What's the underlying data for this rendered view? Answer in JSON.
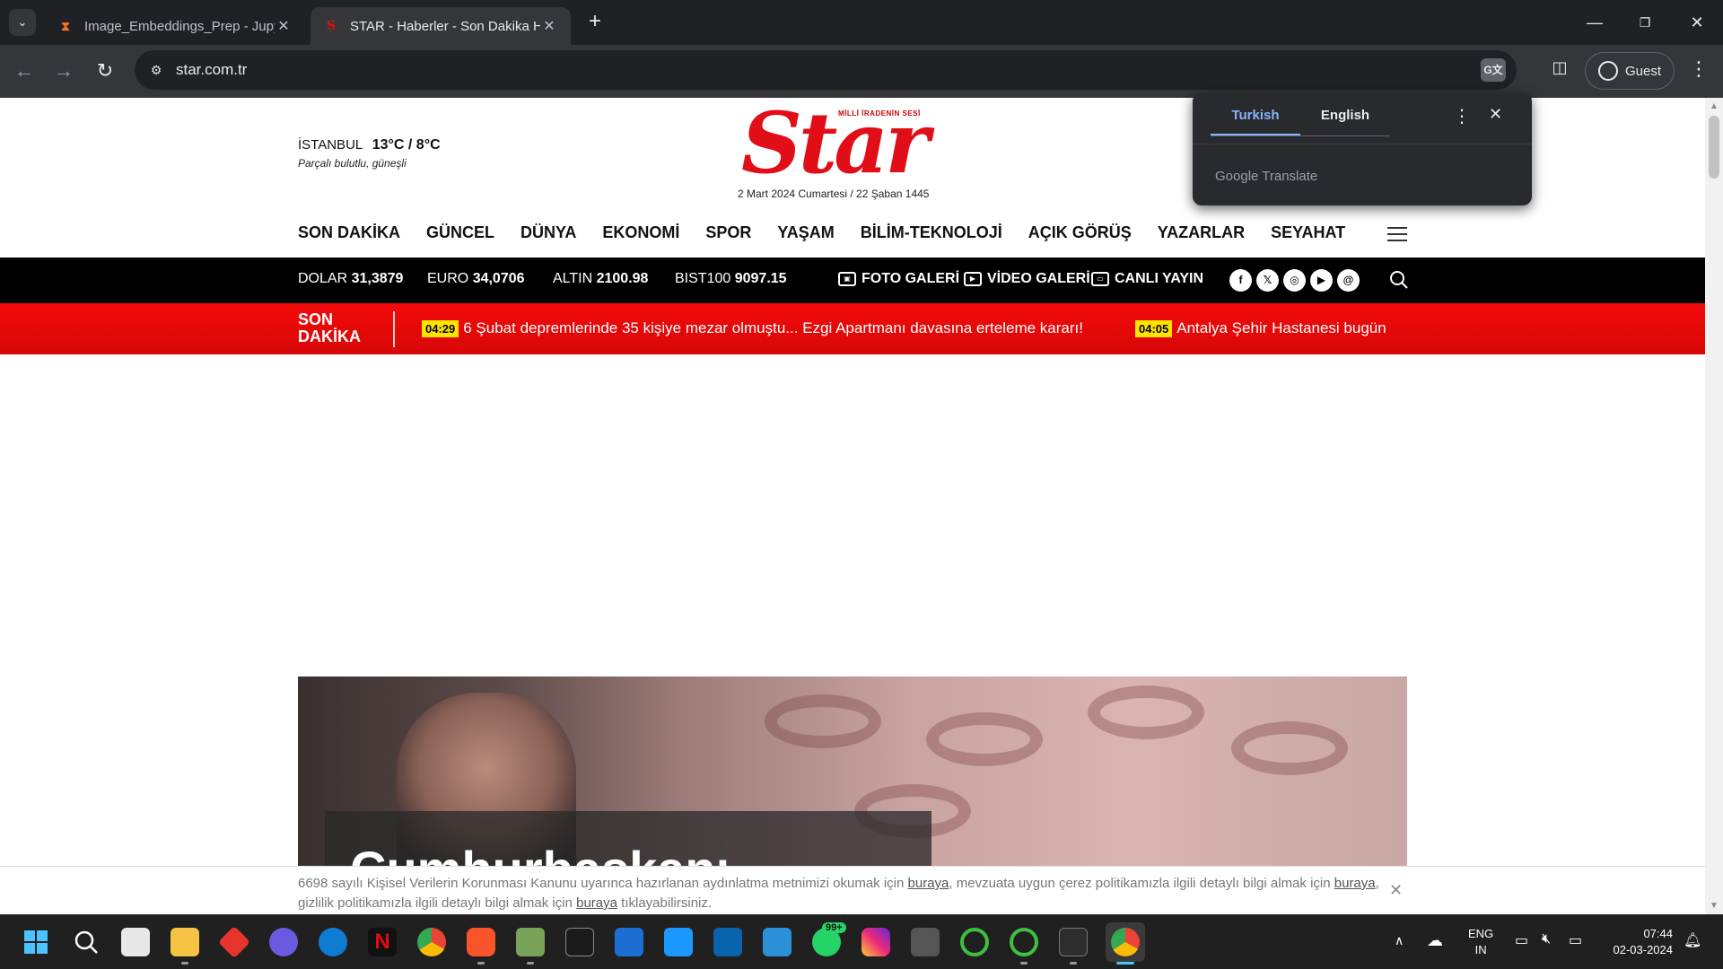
{
  "browser": {
    "tabs": [
      {
        "title": "Image_Embeddings_Prep - Jupyt",
        "favicon": "hourglass-icon",
        "active": false
      },
      {
        "title": "STAR - Haberler - Son Dakika H",
        "favicon": "star-s-icon",
        "active": true
      }
    ],
    "url": "star.com.tr",
    "profile_label": "Guest",
    "translate_popup": {
      "source_lang": "Turkish",
      "target_lang": "English",
      "brand": "Google Translate"
    }
  },
  "site": {
    "weather": {
      "city": "İSTANBUL",
      "temp": "13°C / 8°C",
      "desc": "Parçalı bulutlu, güneşli"
    },
    "logo": {
      "word": "Star",
      "tagline": "MİLLİ İRADENİN SESİ"
    },
    "date": "2 Mart 2024 Cumartesi / 22 Şaban 1445",
    "nav": [
      "SON DAKİKA",
      "GÜNCEL",
      "DÜNYA",
      "EKONOMİ",
      "SPOR",
      "YAŞAM",
      "BİLİM-TEKNOLOJİ",
      "AÇIK GÖRÜŞ",
      "YAZARLAR",
      "SEYAHAT"
    ],
    "markets": [
      {
        "name": "DOLAR",
        "value": "31,3879"
      },
      {
        "name": "EURO",
        "value": "34,0706"
      },
      {
        "name": "ALTIN",
        "value": "2100.98"
      },
      {
        "name": "BIST100",
        "value": "9097.15"
      }
    ],
    "media_links": [
      {
        "label": "FOTO GALERİ",
        "icon": "photo-gallery-icon"
      },
      {
        "label": "VİDEO GALERİ",
        "icon": "video-gallery-icon"
      },
      {
        "label": "CANLI YAYIN",
        "icon": "live-tv-icon"
      }
    ],
    "social": [
      {
        "icon": "facebook-icon",
        "glyph": "f"
      },
      {
        "icon": "x-icon",
        "glyph": "𝕏"
      },
      {
        "icon": "instagram-icon",
        "glyph": "◎"
      },
      {
        "icon": "youtube-icon",
        "glyph": "▶"
      },
      {
        "icon": "threads-icon",
        "glyph": "@"
      }
    ],
    "breaking": {
      "label_line1": "SON",
      "label_line2": "DAKİKA",
      "items": [
        {
          "time": "04:29",
          "text": "6 Şubat depremlerinde 35 kişiye mezar olmuştu... Ezgi Apartmanı davasına erteleme kararı!"
        },
        {
          "time": "04:05",
          "text": "Antalya Şehir Hastanesi bugün"
        }
      ]
    },
    "hero_caption": "Cumhurbaşkanı",
    "cookie": {
      "part1": "6698 sayılı Kişisel Verilerin Korunması Kanunu uyarınca hazırlanan aydınlatma metnimizi okumak için",
      "link1": "buraya",
      "part2": ", mevzuata uygun çerez politikamızla ilgili detaylı bilgi almak için",
      "link2": "buraya",
      "part3": ", gizlilik politikamızla ilgili detaylı bilgi almak için",
      "link3": "buraya",
      "part4": "tıklayabilirsiniz."
    }
  },
  "taskbar": {
    "lang_line1": "ENG",
    "lang_line2": "IN",
    "time": "07:44",
    "date": "02-03-2024",
    "whatsapp_badge": "99+"
  },
  "colors": {
    "brand_red": "#e10d17",
    "breaking_red": "#f30a0a",
    "time_badge": "#ffe400",
    "translate_accent": "#8ab4f8"
  }
}
